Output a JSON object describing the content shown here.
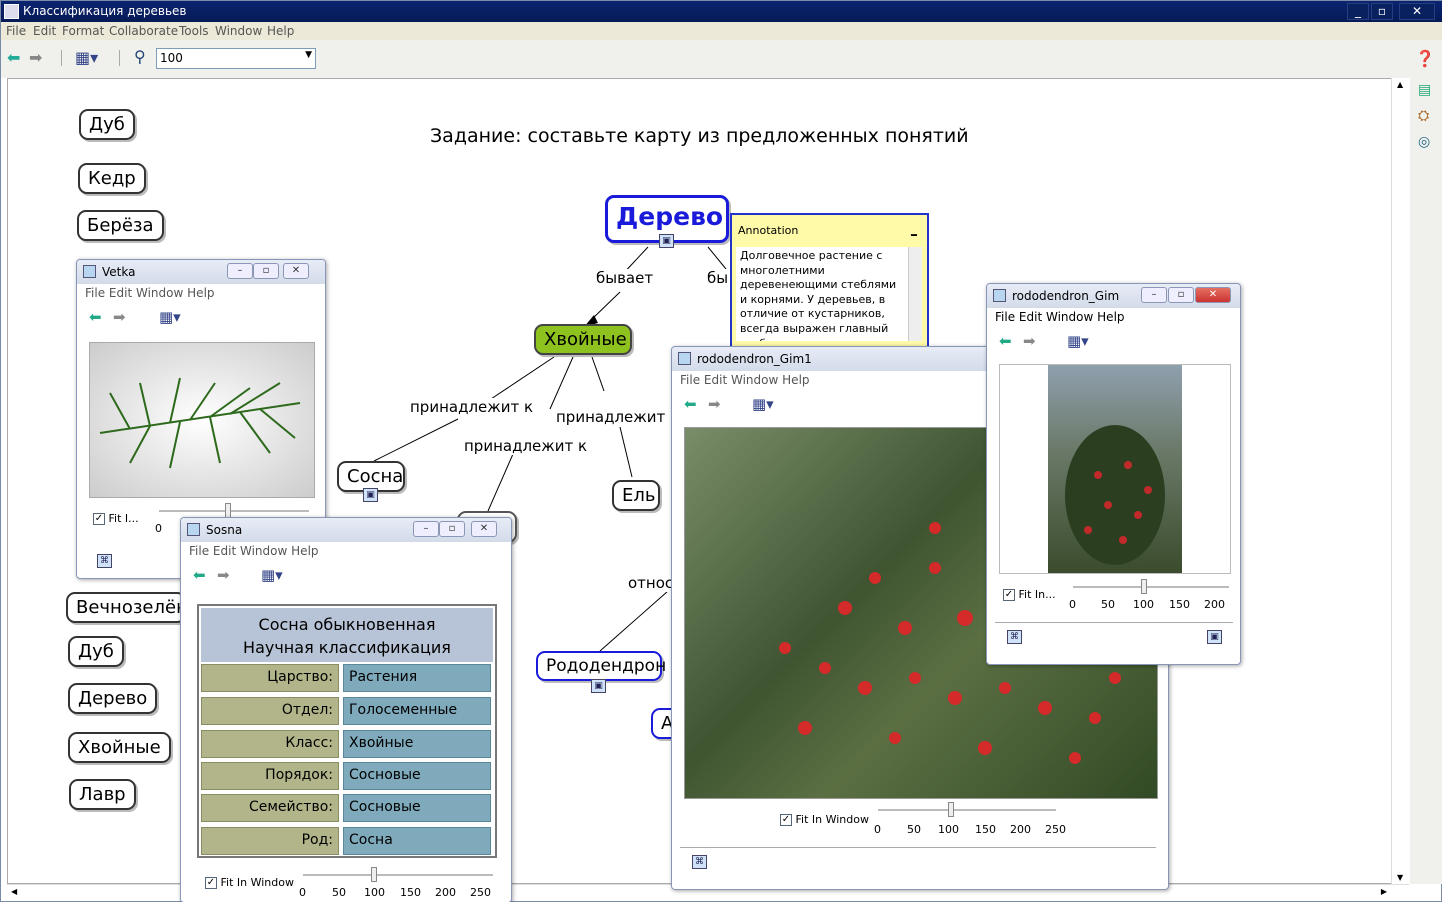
{
  "window": {
    "title": "Классификация деревьев"
  },
  "menu": [
    "File",
    "Edit",
    "Format",
    "Collaborate",
    "Tools",
    "Window",
    "Help"
  ],
  "toolbar": {
    "zoom": "100"
  },
  "task": "Задание: составьте карту из предложенных понятий",
  "concepts_left": [
    "Дуб",
    "Кедр",
    "Берёза",
    "Вечнозелёны",
    "Дуб",
    "Дерево",
    "Хвойные",
    "Лавр"
  ],
  "map": {
    "derevo": "Дерево",
    "hvoynye": "Хвойные",
    "sosna": "Сосна",
    "el": "Ель",
    "rododendron": "Рододендрон",
    "link_byvaet": "бывает",
    "link_by": "бы",
    "link_prinadlezhit1": "принадлежит к",
    "link_prinadlezhit2": "принадлежит к",
    "link_prinadlezhit3": "принадлежит к",
    "link_otnos": "относ",
    "node_a": "А"
  },
  "annotation": {
    "title": "Annotation",
    "collapse": "_",
    "text": "Долговечное растение с многолетними деревенеющими стеблями и корнями. У деревьев, в отличие от кустарников, всегда выражен главный стебель - ствол с"
  },
  "windows": {
    "vetka": {
      "title": "Vetka",
      "menu": [
        "File",
        "Edit",
        "Window",
        "Help"
      ],
      "fit": "Fit I...",
      "scale": [
        "0"
      ]
    },
    "sosna": {
      "title": "Sosna",
      "menu": [
        "File",
        "Edit",
        "Window",
        "Help"
      ],
      "fit": "Fit In Window",
      "scale": [
        "0",
        "50",
        "100",
        "150",
        "200",
        "250"
      ],
      "table": {
        "header1": "Сосна обыкновенная",
        "header2": "Научная классификация",
        "rows": [
          {
            "k": "Царство:",
            "v": "Растения"
          },
          {
            "k": "Отдел:",
            "v": "Голосеменные"
          },
          {
            "k": "Класс:",
            "v": "Хвойные"
          },
          {
            "k": "Порядок:",
            "v": "Сосновые"
          },
          {
            "k": "Семейство:",
            "v": "Сосновые"
          },
          {
            "k": "Род:",
            "v": "Сосна"
          }
        ]
      }
    },
    "rodoGim1": {
      "title": "rododendron_Gim1",
      "menu": [
        "File",
        "Edit",
        "Window",
        "Help"
      ],
      "fit": "Fit In Window",
      "scale": [
        "0",
        "50",
        "100",
        "150",
        "200",
        "250"
      ]
    },
    "rodoGim": {
      "title": "rododendron_Gim",
      "menu": [
        "File",
        "Edit",
        "Window",
        "Help"
      ],
      "fit": "Fit In...",
      "scale": [
        "0",
        "50",
        "100",
        "150",
        "200"
      ]
    }
  },
  "colors": {
    "derevo": "#1a1adb",
    "hvoynye_bg": "#8dc21f",
    "accent": "#2233cc"
  }
}
